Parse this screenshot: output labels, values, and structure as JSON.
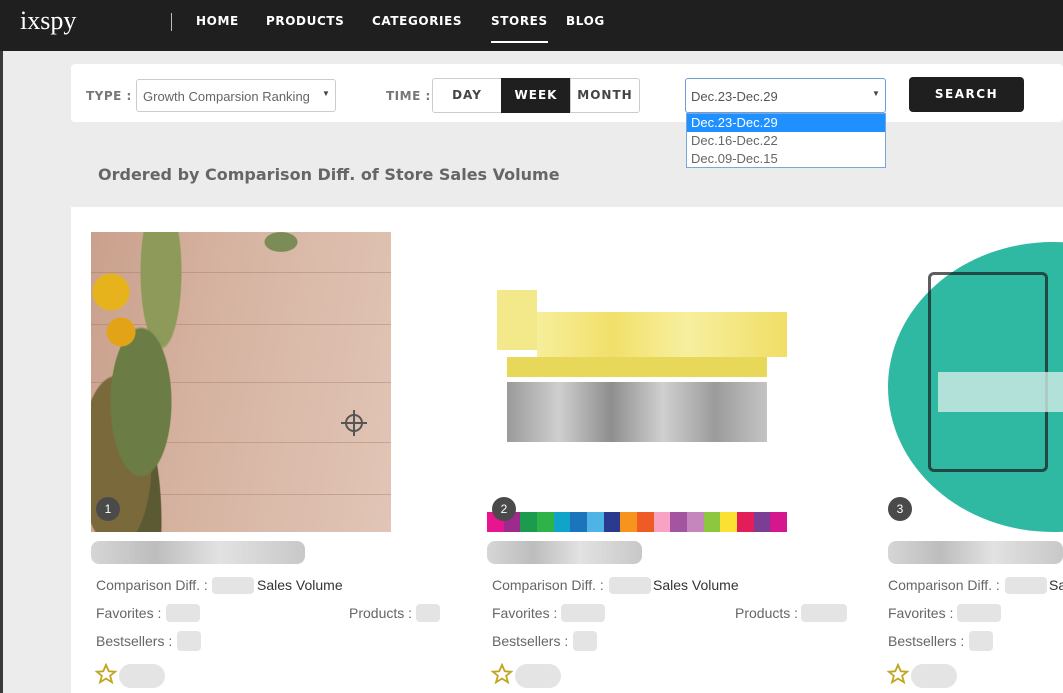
{
  "app": {
    "logo": "ixspy"
  },
  "nav": [
    {
      "label": "HOME"
    },
    {
      "label": "PRODUCTS"
    },
    {
      "label": "CATEGORIES"
    },
    {
      "label": "STORES",
      "active": true
    },
    {
      "label": "BLOG"
    }
  ],
  "filters": {
    "type_label": "TYPE :",
    "type_value": "Growth Comparsion Ranking",
    "time_label": "TIME :",
    "time_options": [
      "DAY",
      "WEEK",
      "MONTH"
    ],
    "time_selected": "WEEK",
    "date_value": "Dec.23-Dec.29",
    "date_options": [
      "Dec.23-Dec.29",
      "Dec.16-Dec.22",
      "Dec.09-Dec.15"
    ],
    "search_label": "SEARCH"
  },
  "section_title": "Ordered by Comparison Diff. of Store Sales Volume",
  "stores": [
    {
      "rank": "1",
      "comparison_label": "Comparison Diff. :",
      "comparison_suffix": "Sales Volume",
      "favorites_label": "Favorites :",
      "products_label": "Products :",
      "bestsellers_label": "Bestsellers :"
    },
    {
      "rank": "2",
      "comparison_label": "Comparison Diff. :",
      "comparison_suffix": "Sales Volume",
      "favorites_label": "Favorites :",
      "products_label": "Products :",
      "bestsellers_label": "Bestsellers :"
    },
    {
      "rank": "3",
      "comparison_label": "Comparison Diff. :",
      "comparison_suffix": "Sa",
      "favorites_label": "Favorites :",
      "bestsellers_label": "Bestsellers :"
    }
  ],
  "icons": {
    "crosshair": "crosshair-icon",
    "star": "star-outline-icon",
    "caret": "caret-down-icon"
  },
  "colors": {
    "nav_bg": "#1f1f1f",
    "accent_select": "#1e90ff",
    "star": "#c2a621",
    "teal": "#2fb9a3"
  }
}
